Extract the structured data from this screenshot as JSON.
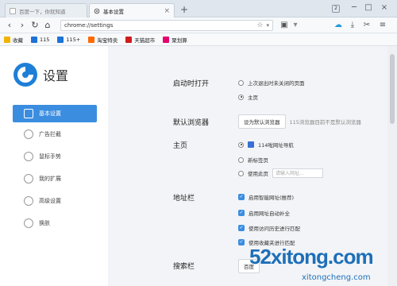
{
  "tabs": [
    {
      "label": "百度一下，你就知道"
    },
    {
      "label": "基本设置"
    }
  ],
  "window": {
    "count": "2"
  },
  "address": {
    "url": "chrome://settings"
  },
  "bookmarks": [
    {
      "label": "收藏",
      "color": "#f0b400"
    },
    {
      "label": "115",
      "color": "#1e73d8"
    },
    {
      "label": "115+",
      "color": "#1e73d8"
    },
    {
      "label": "淘宝特卖",
      "color": "#ff6a00"
    },
    {
      "label": "天猫超市",
      "color": "#d01c1c"
    },
    {
      "label": "聚划算",
      "color": "#e6006e"
    }
  ],
  "sidebar": {
    "title": "设置",
    "items": [
      {
        "label": "基本设置",
        "icon": "basic-settings-icon"
      },
      {
        "label": "广告拦截",
        "icon": "ad-block-icon"
      },
      {
        "label": "鼠标手势",
        "icon": "mouse-gesture-icon"
      },
      {
        "label": "我的扩展",
        "icon": "extension-icon"
      },
      {
        "label": "高级设置",
        "icon": "advanced-settings-icon"
      },
      {
        "label": "换肤",
        "icon": "skin-icon"
      }
    ]
  },
  "startup": {
    "title": "启动时打开",
    "options": [
      "上次退出时未关闭的页面",
      "主页"
    ]
  },
  "default_browser": {
    "title": "默认浏览器",
    "button": "设为默认浏览器",
    "note": "115浏览器目前不是默认浏览器"
  },
  "homepage": {
    "title": "主页",
    "options": [
      "114啦网址导航",
      "新标签页",
      "使用此页"
    ],
    "input_placeholder": "请输入网址..."
  },
  "addressbar": {
    "title": "地址栏",
    "options": [
      "启用智能网址(推荐)",
      "启用网址自动补全",
      "使用访问历史进行匹配",
      "使用收藏夹进行匹配"
    ]
  },
  "search": {
    "title": "搜索栏",
    "button": "百度"
  },
  "watermark": {
    "main": "52xitong.com",
    "sub": "xitongcheng.com"
  },
  "colors": {
    "accent": "#3b8de0",
    "content_bg": "#f2f4f7"
  }
}
